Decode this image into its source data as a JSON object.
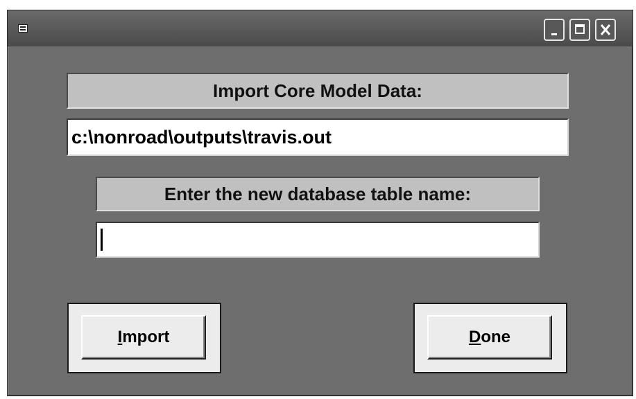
{
  "titlebar": {
    "system_icon": "form-icon",
    "controls": [
      "minimize-icon",
      "maximize-icon",
      "close-icon"
    ]
  },
  "form": {
    "heading": "Import Core Model Data:",
    "file_path": "c:\\nonroad\\outputs\\travis.out",
    "table_prompt": "Enter the new database table name:",
    "table_name_value": ""
  },
  "buttons": {
    "import": {
      "access_key": "I",
      "rest": "mport"
    },
    "done": {
      "access_key": "D",
      "rest": "one"
    }
  }
}
